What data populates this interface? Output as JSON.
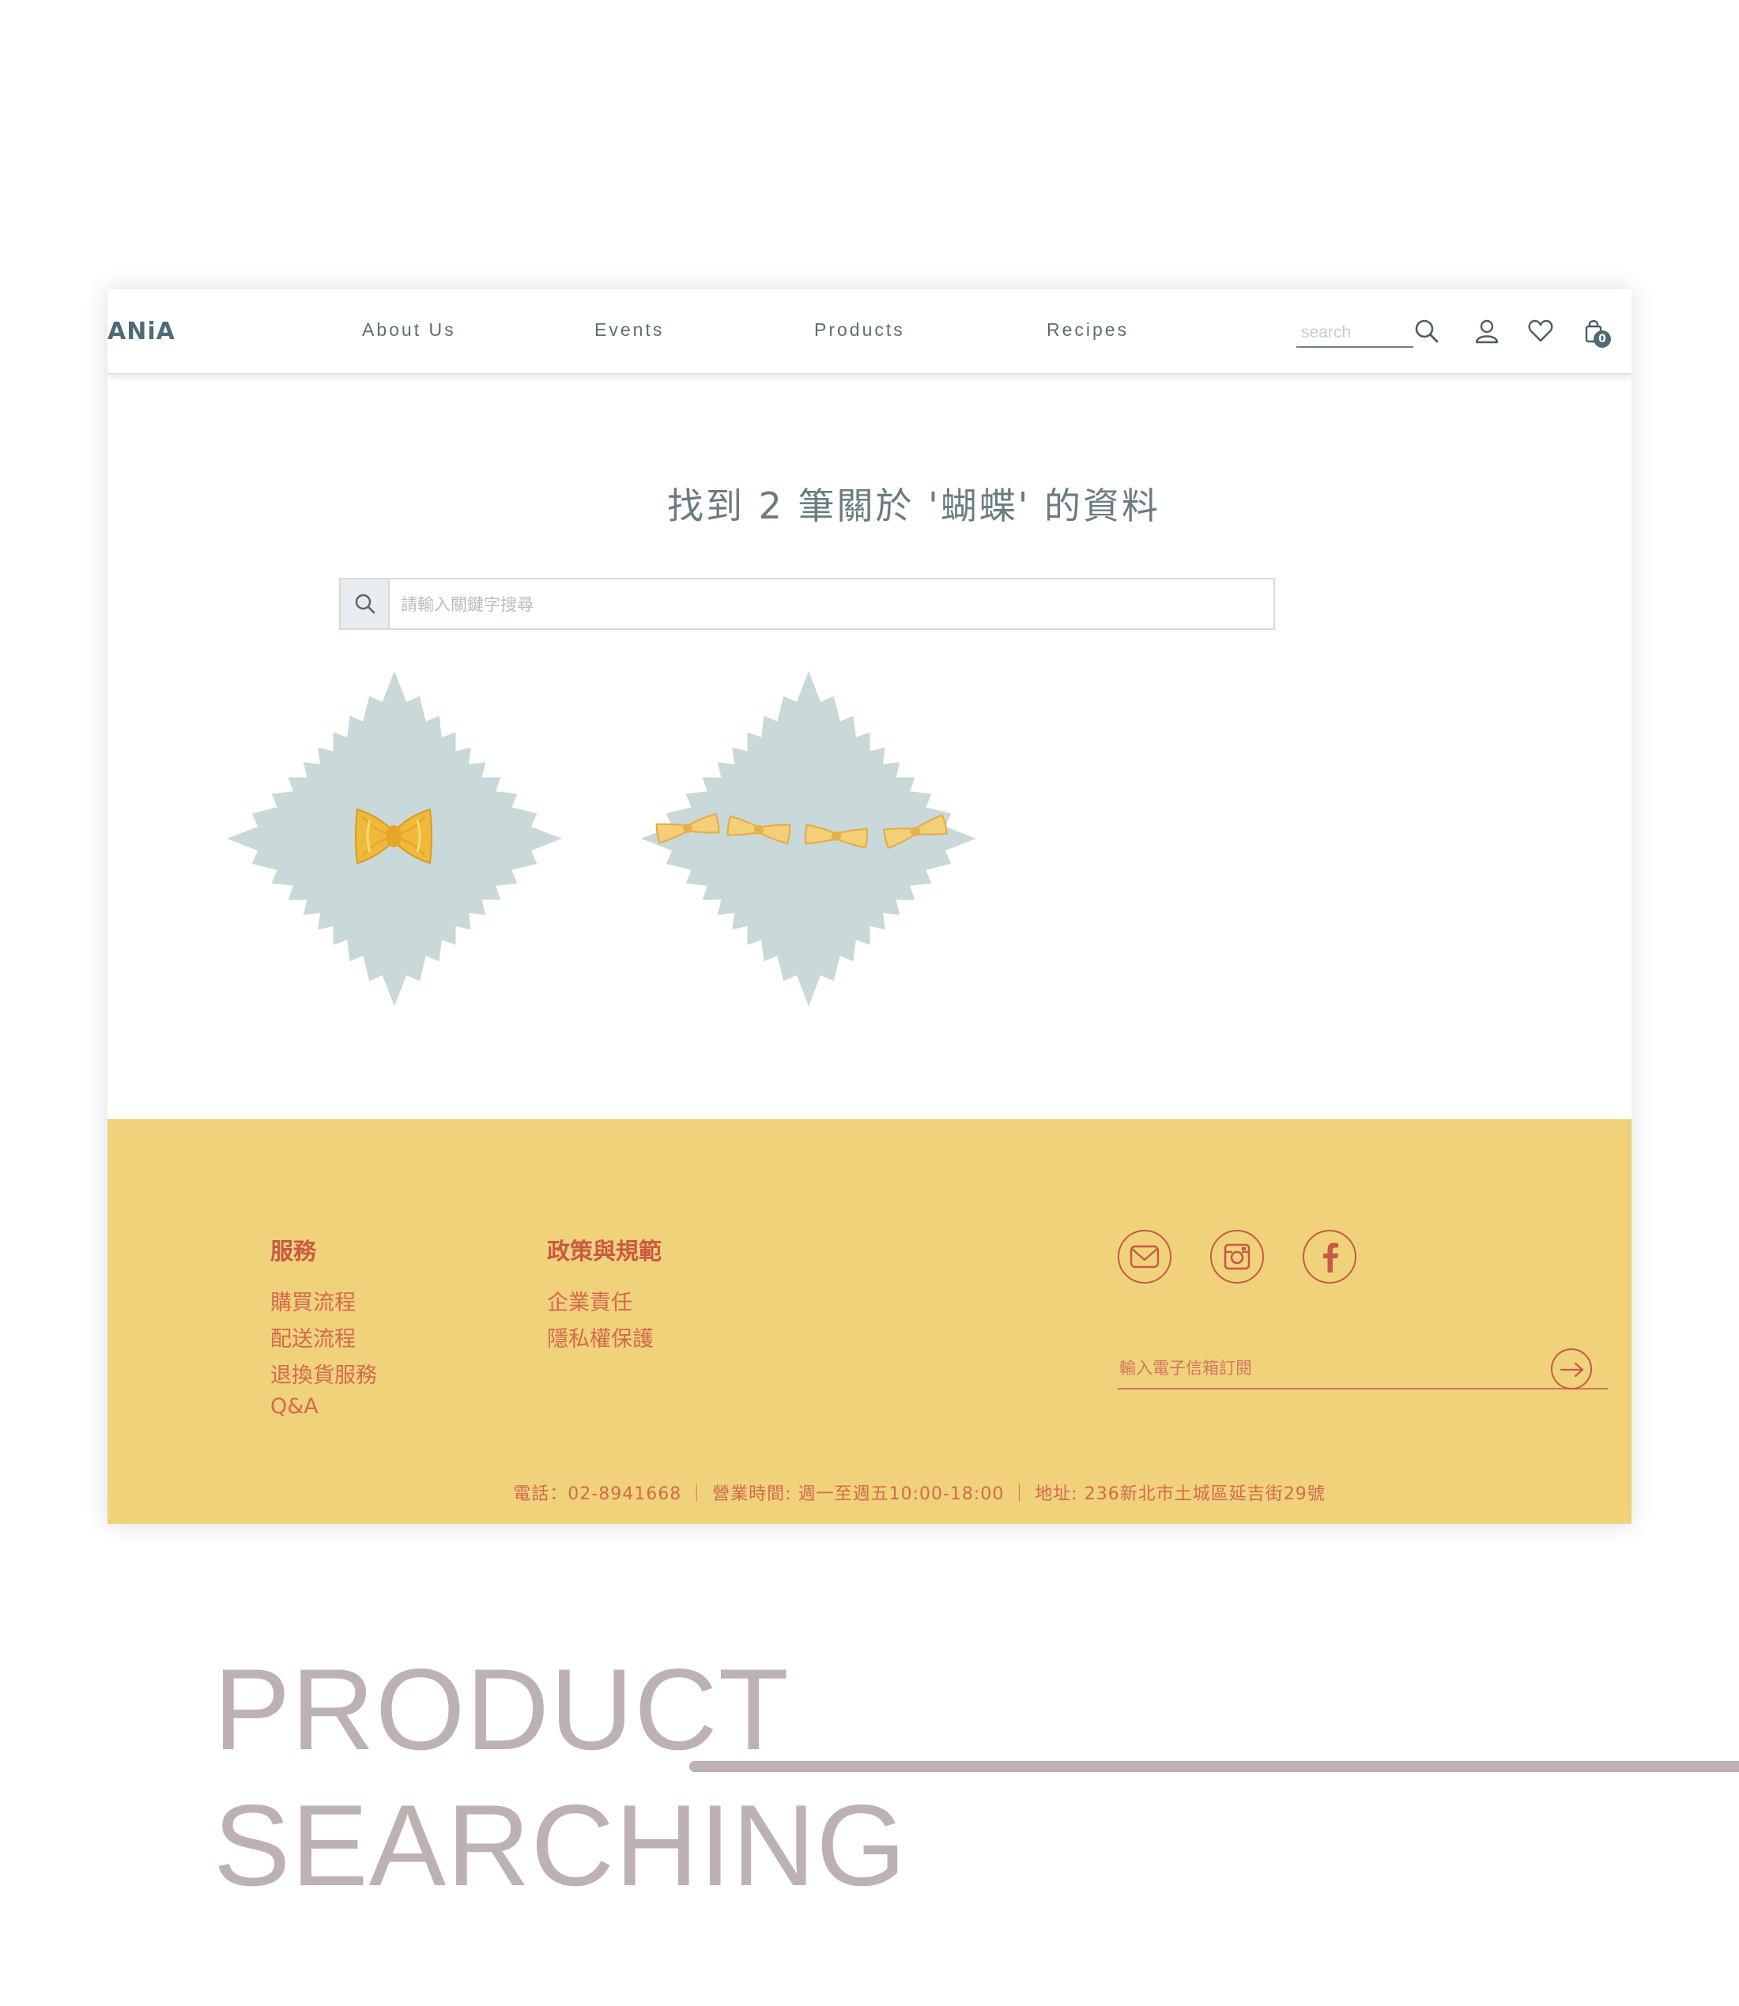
{
  "header": {
    "logo": "ANiA",
    "nav": [
      {
        "label": "About Us"
      },
      {
        "label": "Events"
      },
      {
        "label": "Products"
      },
      {
        "label": "Recipes"
      }
    ],
    "search_placeholder": "search",
    "cart_count": "0"
  },
  "results": {
    "title": "找到 2 筆關於 '蝴蝶' 的資料",
    "search_placeholder": "請輸入關鍵字搜尋"
  },
  "footer": {
    "services": {
      "heading": "服務",
      "links": [
        "購買流程",
        "配送流程",
        "退換貨服務",
        "Q&A"
      ]
    },
    "policies": {
      "heading": "政策與規範",
      "links": [
        "企業責任",
        "隱私權保護"
      ]
    },
    "subscribe_placeholder": "輸入電子信箱訂閱",
    "contact": "電話：02-8941668 ｜ 營業時間: 週一至週五10:00-18:00 ｜ 地址: 236新北市土城區延吉街29號"
  },
  "caption": {
    "line1": "PRODUCT",
    "line2": "SEARCHING"
  },
  "colors": {
    "accent": "#4e6b74",
    "footer_bg": "#f0d27a",
    "footer_text": "#c95a45",
    "card_bg": "#c9d8d8",
    "caption": "#bdb1b1"
  }
}
